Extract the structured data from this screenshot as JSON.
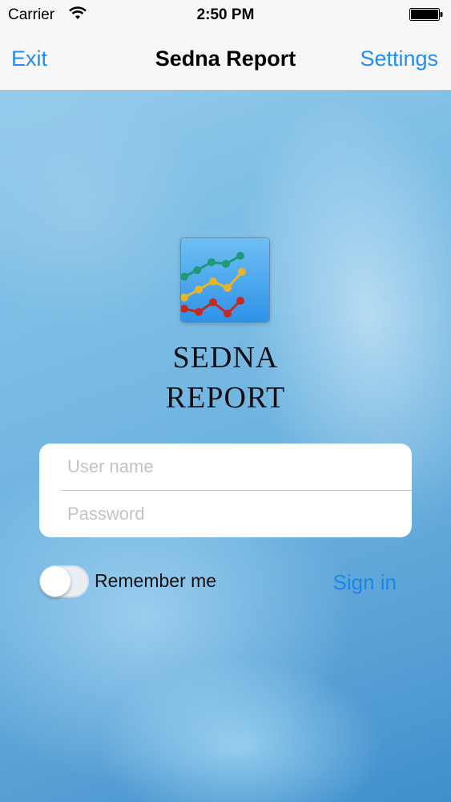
{
  "status_bar": {
    "carrier": "Carrier",
    "time": "2:50 PM",
    "wifi_icon": "wifi-icon",
    "battery_icon": "battery-icon",
    "battery_level": 1.0
  },
  "nav_bar": {
    "left_label": "Exit",
    "title": "Sedna Report",
    "right_label": "Settings"
  },
  "brand": {
    "logo_icon": "line-chart-icon",
    "line1": "SEDNA",
    "line2": "REPORT"
  },
  "login": {
    "username_placeholder": "User name",
    "username_value": "",
    "password_placeholder": "Password",
    "password_value": "",
    "remember_label": "Remember me",
    "remember_on": false,
    "sign_in_label": "Sign in"
  },
  "colors": {
    "accent": "#1e8ef2",
    "background_top": "#9fd1ee",
    "background_bottom": "#3f8fcc"
  }
}
